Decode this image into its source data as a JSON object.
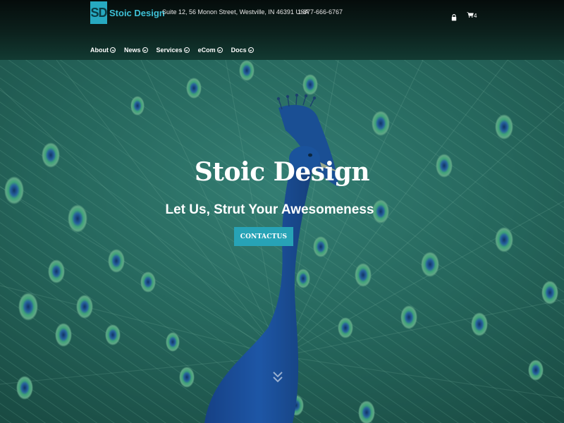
{
  "brand": {
    "logo_mark": "SD",
    "name": "Stoic Design",
    "accent": "#27a9c0"
  },
  "header": {
    "address": "Suite 12, 56 Monon Street, Westville, IN 46391 USA",
    "phone": "1-877-666-6767",
    "cart_count": "4",
    "icons": [
      "lock-icon",
      "cart-icon"
    ]
  },
  "nav": {
    "items": [
      {
        "label": "About"
      },
      {
        "label": "News"
      },
      {
        "label": "Services"
      },
      {
        "label": "eCom"
      },
      {
        "label": "Docs"
      }
    ]
  },
  "hero": {
    "title": "Stoic Design",
    "subtitle": "Let Us, Strut Your Awesomeness",
    "cta_label": "CONTACTUS",
    "cta_color": "#27a3b6"
  }
}
